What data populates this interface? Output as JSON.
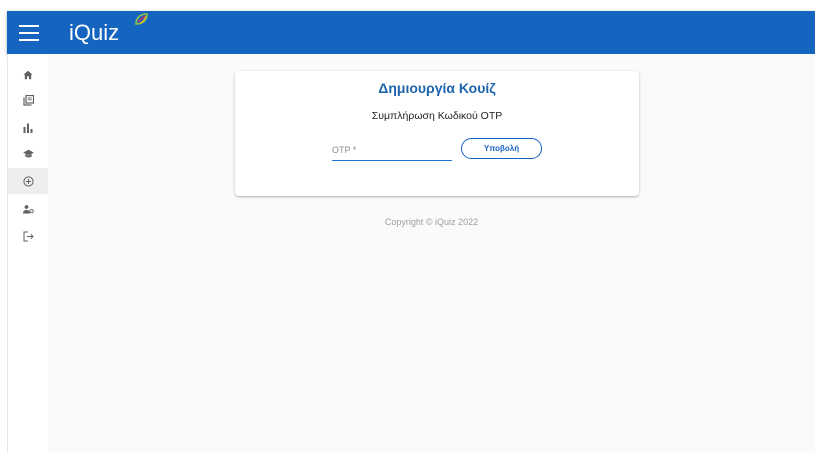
{
  "app": {
    "title": "iQuiz",
    "colors": {
      "appbar": "#1565c0",
      "accent": "#1e63ad",
      "background": "#fafafa"
    }
  },
  "header": {
    "menu_icon": "hamburger-menu-icon",
    "logo_text": "iQuiz",
    "logo_icon": "leaf-logo-icon"
  },
  "sidebar": {
    "items": [
      {
        "icon": "home-icon",
        "active": false
      },
      {
        "icon": "library-books-icon",
        "active": false
      },
      {
        "icon": "bar-chart-icon",
        "active": false
      },
      {
        "icon": "graduation-cap-icon",
        "active": false
      },
      {
        "icon": "add-circle-outline-icon",
        "active": true
      },
      {
        "icon": "manage-accounts-icon",
        "active": false
      },
      {
        "icon": "logout-icon",
        "active": false
      }
    ]
  },
  "card": {
    "title": "Δημιουργία Κουίζ",
    "subtitle": "Συμπλήρωση Κωδικού OTP",
    "otp_placeholder": "OTP *",
    "otp_value": "",
    "submit_label": "Υποβολή"
  },
  "footer": {
    "copyright": "Copyright © iQuiz 2022"
  }
}
